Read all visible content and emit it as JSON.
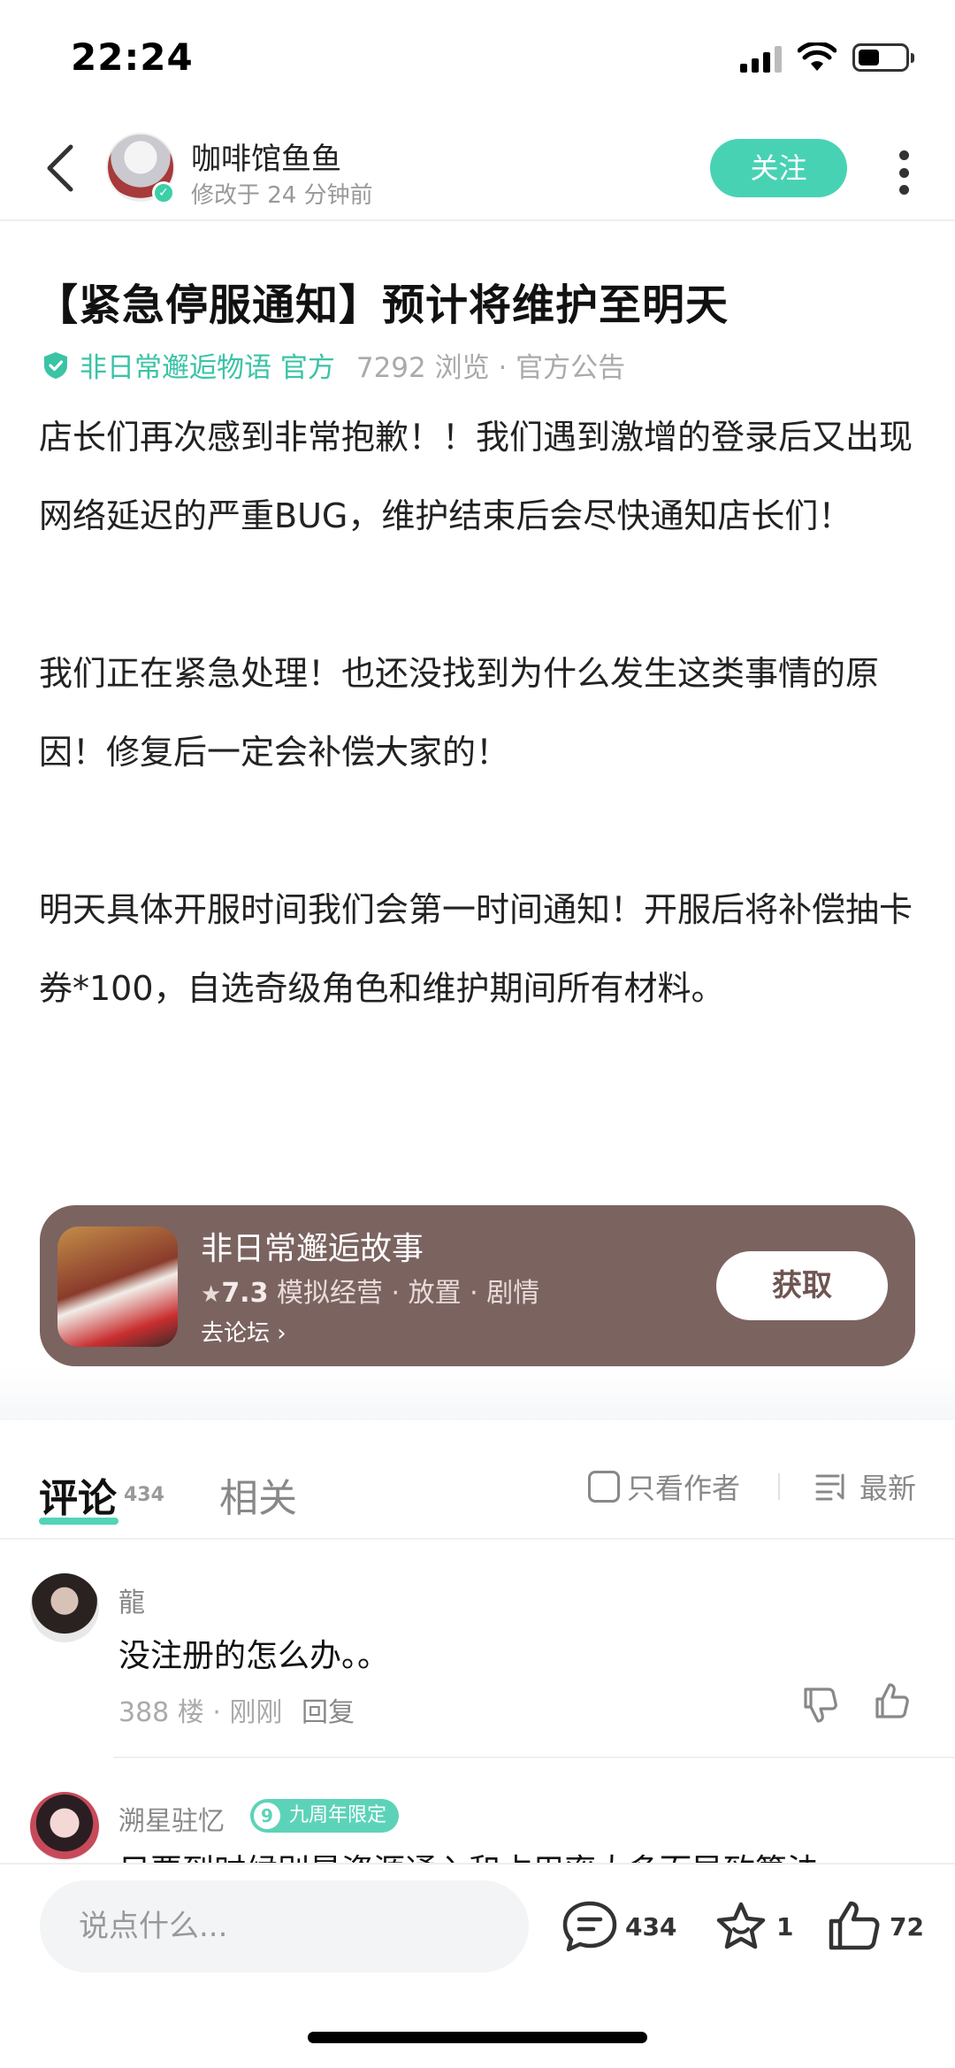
{
  "status_bar": {
    "time": "22:24",
    "battery_level": 0.45
  },
  "header": {
    "author_name": "咖啡馆鱼鱼",
    "edited_time": "修改于 24 分钟前",
    "follow_label": "关注"
  },
  "article": {
    "title": "【紧急停服通知】预计将维护至明天",
    "source_name": "非日常邂逅物语 官方",
    "views": "7292 浏览",
    "category": "官方公告",
    "paragraphs": [
      "店长们再次感到非常抱歉！！我们遇到激增的登录后又出现网络延迟的严重BUG，维护结束后会尽快通知店长们！",
      "我们正在紧急处理！也还没找到为什么发生这类事情的原因！修复后一定会补偿大家的！",
      "明天具体开服时间我们会第一时间通知！开服后将补偿抽卡券*100，自选奇级角色和维护期间所有材料。"
    ]
  },
  "game_card": {
    "name": "非日常邂逅故事",
    "rating": "7.3",
    "tags": "模拟经营 · 放置 · 剧情",
    "forum_link": "去论坛",
    "get_label": "获取"
  },
  "tabs": {
    "comments_label": "评论",
    "comments_count": "434",
    "related_label": "相关",
    "author_only_label": "只看作者",
    "sort_label": "最新"
  },
  "comments": [
    {
      "user": "龍",
      "text": "没注册的怎么办。。",
      "floor": "388 楼",
      "time": "刚刚",
      "reply_label": "回复"
    },
    {
      "user": "溯星驻忆",
      "badge_num": "9",
      "badge_text": "九周年限定",
      "text": "只要到时候别是资源通入和占用率太多而导致算法"
    }
  ],
  "bottom_bar": {
    "input_placeholder": "说点什么...",
    "comment_count": "434",
    "favorite_count": "1",
    "like_count": "72"
  },
  "colors": {
    "accent": "#48d2b4",
    "card_bg": "#7b6360"
  }
}
